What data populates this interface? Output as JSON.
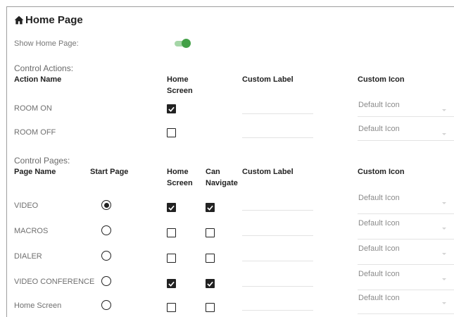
{
  "page": {
    "title": "Home Page"
  },
  "show_home_page": {
    "label": "Show Home Page:",
    "enabled": true,
    "accent": "#43a047",
    "track": "#a5d6a7"
  },
  "control_actions": {
    "section_label": "Control Actions:",
    "headers": {
      "name": "Action Name",
      "home_screen": "Home Screen",
      "custom_label": "Custom Label",
      "custom_icon": "Custom Icon"
    },
    "rows": [
      {
        "name": "ROOM ON",
        "home_screen": true,
        "custom_label": "",
        "custom_icon": "Default Icon"
      },
      {
        "name": "ROOM OFF",
        "home_screen": false,
        "custom_label": "",
        "custom_icon": "Default Icon"
      }
    ]
  },
  "control_pages": {
    "section_label": "Control Pages:",
    "headers": {
      "name": "Page Name",
      "start_page": "Start Page",
      "home_screen": "Home Screen",
      "can_navigate": "Can Navigate",
      "custom_label": "Custom Label",
      "custom_icon": "Custom Icon"
    },
    "rows": [
      {
        "name": "VIDEO",
        "start_page": true,
        "home_screen": true,
        "can_navigate": true,
        "custom_label": "",
        "custom_icon": "Default Icon"
      },
      {
        "name": "MACROS",
        "start_page": false,
        "home_screen": false,
        "can_navigate": false,
        "custom_label": "",
        "custom_icon": "Default Icon"
      },
      {
        "name": "DIALER",
        "start_page": false,
        "home_screen": false,
        "can_navigate": false,
        "custom_label": "",
        "custom_icon": "Default Icon"
      },
      {
        "name": "VIDEO CONFERENCE",
        "start_page": false,
        "home_screen": true,
        "can_navigate": true,
        "custom_label": "",
        "custom_icon": "Default Icon"
      },
      {
        "name": "Home Screen",
        "start_page": false,
        "home_screen": false,
        "can_navigate": false,
        "custom_label": "",
        "custom_icon": "Default Icon"
      }
    ]
  },
  "icons": {
    "title_icon": "home-icon",
    "select_icon": "chevron-down-icon",
    "check_icon": "check-icon"
  }
}
